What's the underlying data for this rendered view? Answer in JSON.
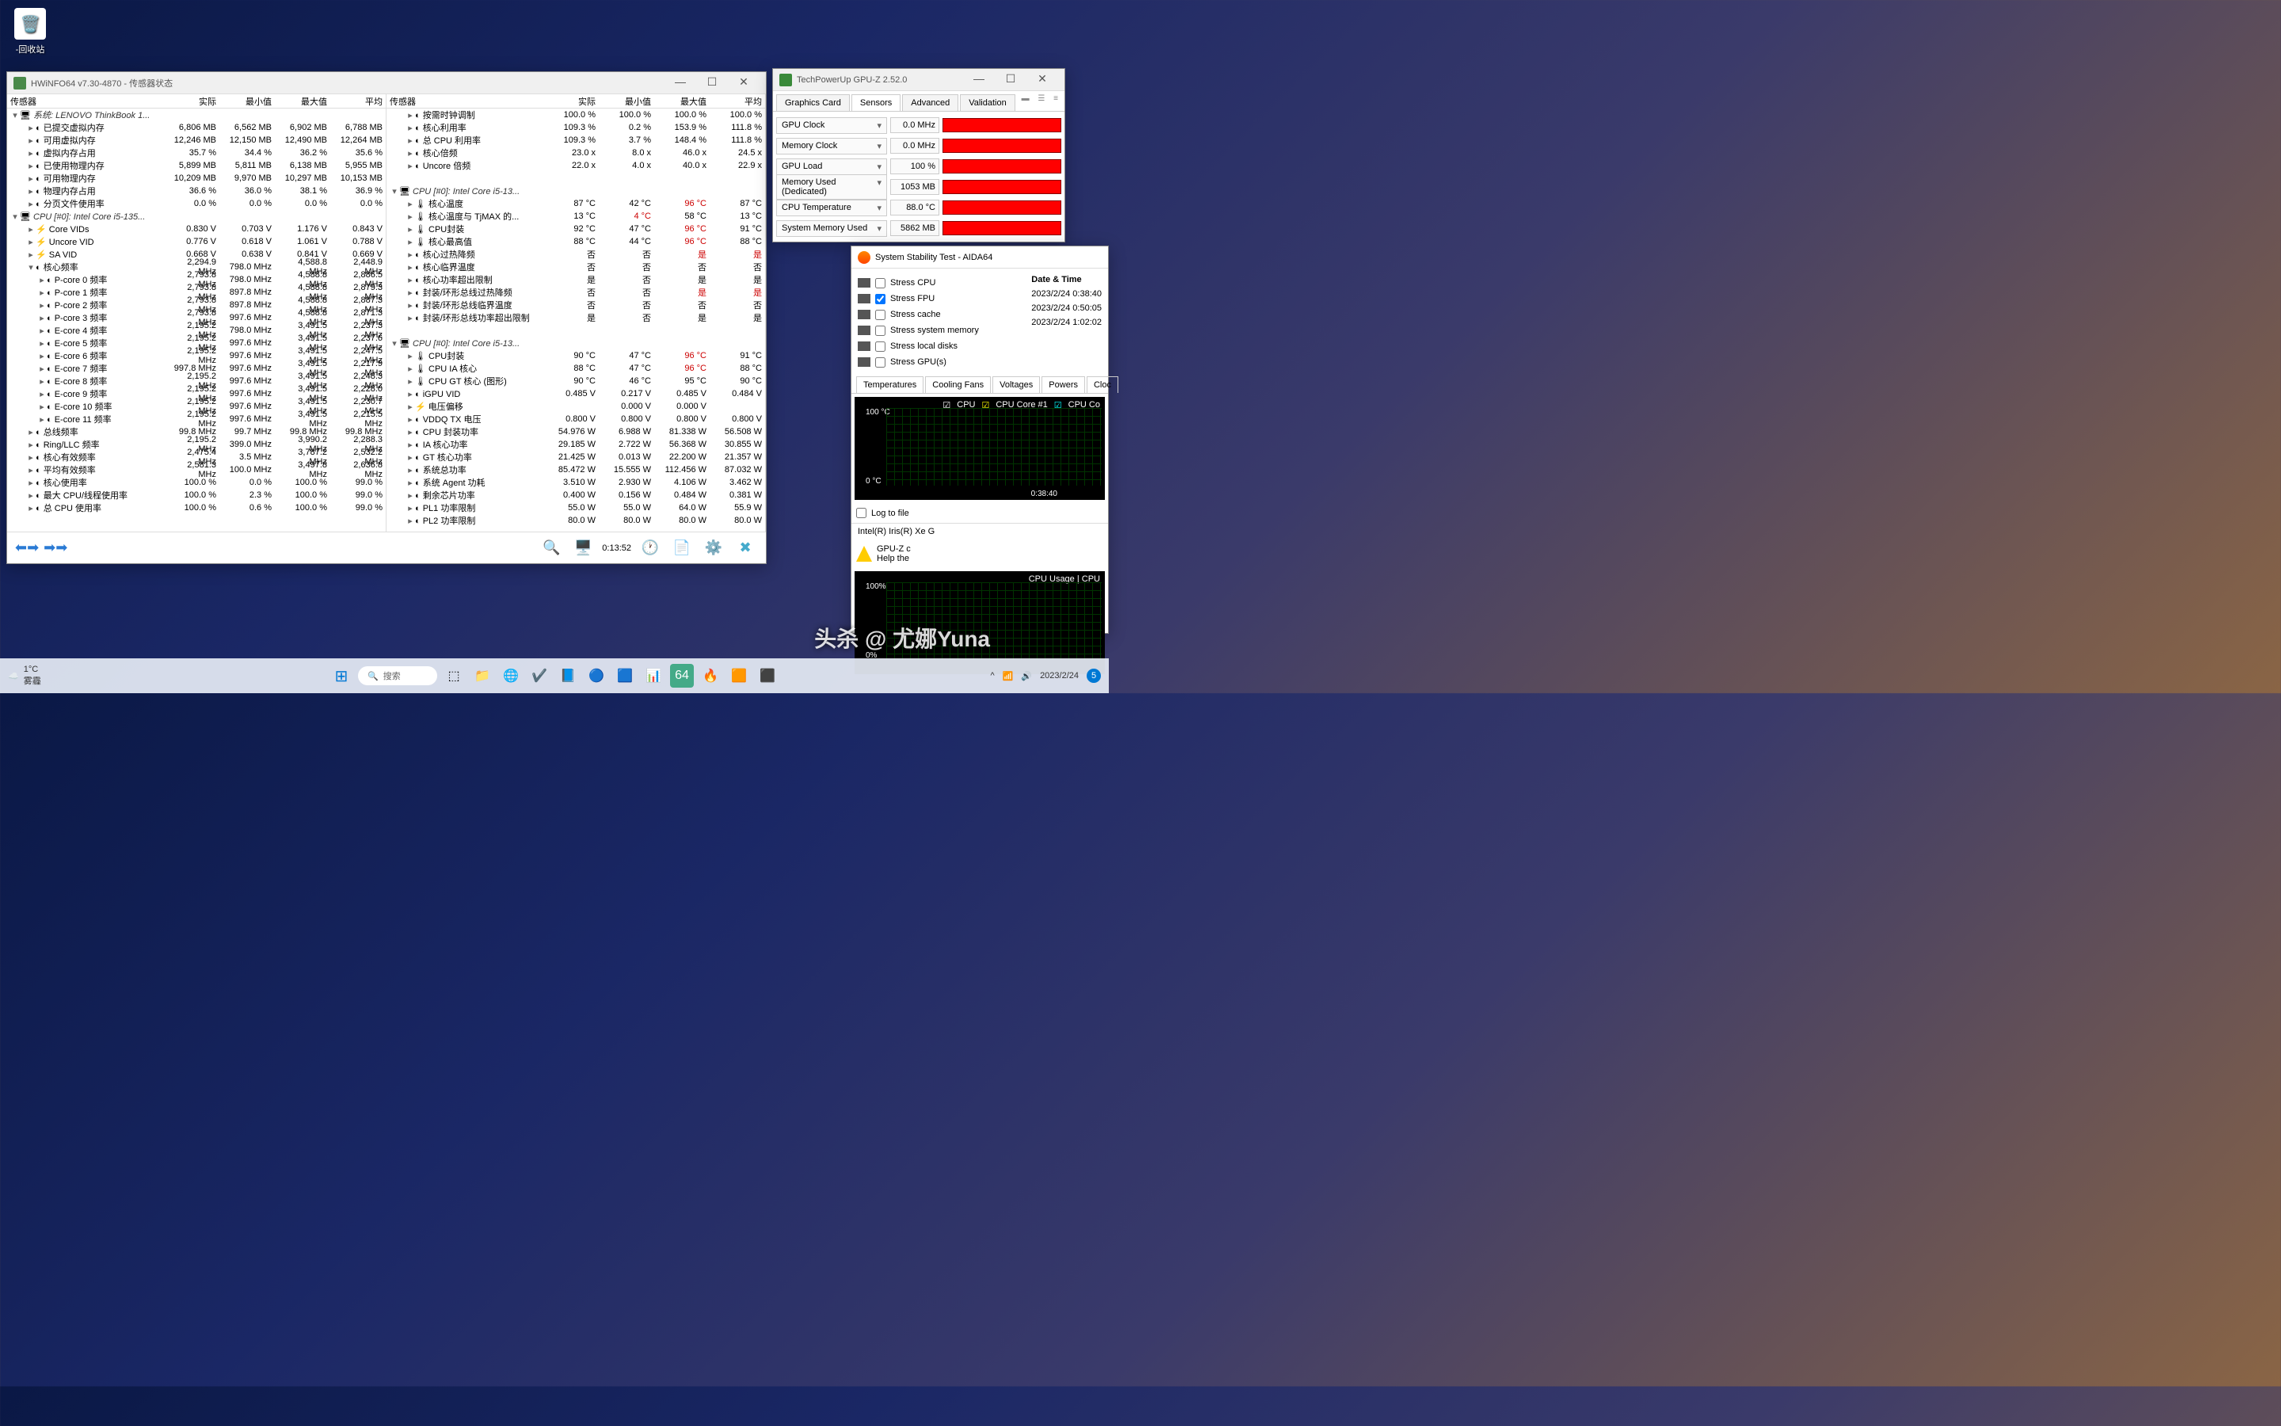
{
  "desktop": {
    "recycle": "-回收站"
  },
  "hwinfo": {
    "title": "HWiNFO64 v7.30-4870 - 传感器状态",
    "hdr": [
      "传感器",
      "实际",
      "最小值",
      "最大值",
      "平均"
    ],
    "left": [
      {
        "t": "grp",
        "n": "系统: LENOVO ThinkBook 1...",
        "i": 0
      },
      {
        "n": "已提交虚拟内存",
        "v": [
          "6,806 MB",
          "6,562 MB",
          "6,902 MB",
          "6,788 MB"
        ],
        "i": 1
      },
      {
        "n": "可用虚拟内存",
        "v": [
          "12,246 MB",
          "12,150 MB",
          "12,490 MB",
          "12,264 MB"
        ],
        "i": 1
      },
      {
        "n": "虚拟内存占用",
        "v": [
          "35.7 %",
          "34.4 %",
          "36.2 %",
          "35.6 %"
        ],
        "i": 1
      },
      {
        "n": "已使用物理内存",
        "v": [
          "5,899 MB",
          "5,811 MB",
          "6,138 MB",
          "5,955 MB"
        ],
        "i": 1
      },
      {
        "n": "可用物理内存",
        "v": [
          "10,209 MB",
          "9,970 MB",
          "10,297 MB",
          "10,153 MB"
        ],
        "i": 1
      },
      {
        "n": "物理内存占用",
        "v": [
          "36.6 %",
          "36.0 %",
          "38.1 %",
          "36.9 %"
        ],
        "i": 1
      },
      {
        "n": "分页文件使用率",
        "v": [
          "0.0 %",
          "0.0 %",
          "0.0 %",
          "0.0 %"
        ],
        "i": 1
      },
      {
        "t": "grp",
        "n": "CPU [#0]: Intel Core i5-135...",
        "i": 0
      },
      {
        "n": "Core VIDs",
        "v": [
          "0.830 V",
          "0.703 V",
          "1.176 V",
          "0.843 V"
        ],
        "i": 1,
        "ic": "⚡"
      },
      {
        "n": "Uncore VID",
        "v": [
          "0.776 V",
          "0.618 V",
          "1.061 V",
          "0.788 V"
        ],
        "i": 1,
        "ic": "⚡"
      },
      {
        "n": "SA VID",
        "v": [
          "0.668 V",
          "0.638 V",
          "0.841 V",
          "0.669 V"
        ],
        "i": 1,
        "ic": "⚡"
      },
      {
        "n": "核心频率",
        "v": [
          "2,294.9 MHz",
          "798.0 MHz",
          "4,588.8 MHz",
          "2,448.9 MHz"
        ],
        "i": 1,
        "exp": "v"
      },
      {
        "n": "P-core 0 频率",
        "v": [
          "2,793.8 MHz",
          "798.0 MHz",
          "4,588.8 MHz",
          "2,886.5 MHz"
        ],
        "i": 2
      },
      {
        "n": "P-core 1 频率",
        "v": [
          "2,793.8 MHz",
          "897.8 MHz",
          "4,588.8 MHz",
          "2,879.3 MHz"
        ],
        "i": 2
      },
      {
        "n": "P-core 2 频率",
        "v": [
          "2,793.8 MHz",
          "897.8 MHz",
          "4,588.8 MHz",
          "2,887.3 MHz"
        ],
        "i": 2
      },
      {
        "n": "P-core 3 频率",
        "v": [
          "2,793.8 MHz",
          "997.6 MHz",
          "4,588.8 MHz",
          "2,871.3 MHz"
        ],
        "i": 2
      },
      {
        "n": "E-core 4 频率",
        "v": [
          "2,195.2 MHz",
          "798.0 MHz",
          "3,491.5 MHz",
          "2,237.3 MHz"
        ],
        "i": 2
      },
      {
        "n": "E-core 5 频率",
        "v": [
          "2,195.2 MHz",
          "997.6 MHz",
          "3,491.5 MHz",
          "2,237.6 MHz"
        ],
        "i": 2
      },
      {
        "n": "E-core 6 频率",
        "v": [
          "2,195.2 MHz",
          "997.6 MHz",
          "3,491.5 MHz",
          "2,247.5 MHz"
        ],
        "i": 2
      },
      {
        "n": "E-core 7 频率",
        "v": [
          "997.8 MHz",
          "997.6 MHz",
          "3,491.5 MHz",
          "2,217.9 MHz"
        ],
        "i": 2
      },
      {
        "n": "E-core 8 频率",
        "v": [
          "2,195.2 MHz",
          "997.6 MHz",
          "3,491.5 MHz",
          "2,248.3 MHz"
        ],
        "i": 2
      },
      {
        "n": "E-core 9 频率",
        "v": [
          "2,195.2 MHz",
          "997.6 MHz",
          "3,491.5 MHz",
          "2,228.0 MHz"
        ],
        "i": 2
      },
      {
        "n": "E-core 10 频率",
        "v": [
          "2,195.2 MHz",
          "997.6 MHz",
          "3,491.5 MHz",
          "2,230.7 MHz"
        ],
        "i": 2
      },
      {
        "n": "E-core 11 频率",
        "v": [
          "2,195.2 MHz",
          "997.6 MHz",
          "3,491.5 MHz",
          "2,215.5 MHz"
        ],
        "i": 2
      },
      {
        "n": "总线频率",
        "v": [
          "99.8 MHz",
          "99.7 MHz",
          "99.8 MHz",
          "99.8 MHz"
        ],
        "i": 1
      },
      {
        "n": "Ring/LLC 频率",
        "v": [
          "2,195.2 MHz",
          "399.0 MHz",
          "3,990.2 MHz",
          "2,288.3 MHz"
        ],
        "i": 1
      },
      {
        "n": "核心有效频率",
        "v": [
          "2,475.4 MHz",
          "3.5 MHz",
          "3,787.2 MHz",
          "2,532.2 MHz"
        ],
        "i": 1
      },
      {
        "n": "平均有效频率",
        "v": [
          "2,581.3 MHz",
          "100.0 MHz",
          "3,497.8 MHz",
          "2,636.8 MHz"
        ],
        "i": 1
      },
      {
        "n": "核心使用率",
        "v": [
          "100.0 %",
          "0.0 %",
          "100.0 %",
          "99.0 %"
        ],
        "i": 1
      },
      {
        "n": "最大 CPU/线程使用率",
        "v": [
          "100.0 %",
          "2.3 %",
          "100.0 %",
          "99.0 %"
        ],
        "i": 1
      },
      {
        "n": "总 CPU 使用率",
        "v": [
          "100.0 %",
          "0.6 %",
          "100.0 %",
          "99.0 %"
        ],
        "i": 1
      }
    ],
    "right": [
      {
        "n": "按需时钟调制",
        "v": [
          "100.0 %",
          "100.0 %",
          "100.0 %",
          "100.0 %"
        ],
        "i": 1
      },
      {
        "n": "核心利用率",
        "v": [
          "109.3 %",
          "0.2 %",
          "153.9 %",
          "111.8 %"
        ],
        "i": 1
      },
      {
        "n": "总 CPU 利用率",
        "v": [
          "109.3 %",
          "3.7 %",
          "148.4 %",
          "111.8 %"
        ],
        "i": 1
      },
      {
        "n": "核心倍频",
        "v": [
          "23.0 x",
          "8.0 x",
          "46.0 x",
          "24.5 x"
        ],
        "i": 1
      },
      {
        "n": "Uncore 倍频",
        "v": [
          "22.0 x",
          "4.0 x",
          "40.0 x",
          "22.9 x"
        ],
        "i": 1
      },
      {
        "t": "sp"
      },
      {
        "t": "grp",
        "n": "CPU [#0]: Intel Core i5-13...",
        "i": 0
      },
      {
        "n": "核心温度",
        "v": [
          "87 °C",
          "42 °C",
          "96 °C",
          "87 °C"
        ],
        "i": 1,
        "ic": "🌡",
        "hot": 2
      },
      {
        "n": "核心温度与 TjMAX 的...",
        "v": [
          "13 °C",
          "4 °C",
          "58 °C",
          "13 °C"
        ],
        "i": 1,
        "ic": "🌡",
        "hot": 1
      },
      {
        "n": "CPU封装",
        "v": [
          "92 °C",
          "47 °C",
          "96 °C",
          "91 °C"
        ],
        "i": 1,
        "ic": "🌡",
        "hot": 2
      },
      {
        "n": "核心最高值",
        "v": [
          "88 °C",
          "44 °C",
          "96 °C",
          "88 °C"
        ],
        "i": 1,
        "ic": "🌡",
        "hot": 2
      },
      {
        "n": "核心过热降频",
        "v": [
          "否",
          "否",
          "是",
          "是"
        ],
        "i": 1,
        "hot": 3
      },
      {
        "n": "核心临界温度",
        "v": [
          "否",
          "否",
          "否",
          "否"
        ],
        "i": 1
      },
      {
        "n": "核心功率超出限制",
        "v": [
          "是",
          "否",
          "是",
          "是"
        ],
        "i": 1
      },
      {
        "n": "封装/环形总线过热降频",
        "v": [
          "否",
          "否",
          "是",
          "是"
        ],
        "i": 1,
        "hot": 3
      },
      {
        "n": "封装/环形总线临界温度",
        "v": [
          "否",
          "否",
          "否",
          "否"
        ],
        "i": 1
      },
      {
        "n": "封装/环形总线功率超出限制",
        "v": [
          "是",
          "否",
          "是",
          "是"
        ],
        "i": 1
      },
      {
        "t": "sp"
      },
      {
        "t": "grp",
        "n": "CPU [#0]: Intel Core i5-13...",
        "i": 0
      },
      {
        "n": "CPU封装",
        "v": [
          "90 °C",
          "47 °C",
          "96 °C",
          "91 °C"
        ],
        "i": 1,
        "ic": "🌡",
        "hot": 2
      },
      {
        "n": "CPU IA 核心",
        "v": [
          "88 °C",
          "47 °C",
          "96 °C",
          "88 °C"
        ],
        "i": 1,
        "ic": "🌡",
        "hot": 2
      },
      {
        "n": "CPU GT 核心 (图形)",
        "v": [
          "90 °C",
          "46 °C",
          "95 °C",
          "90 °C"
        ],
        "i": 1,
        "ic": "🌡"
      },
      {
        "n": "iGPU VID",
        "v": [
          "0.485 V",
          "0.217 V",
          "0.485 V",
          "0.484 V"
        ],
        "i": 1
      },
      {
        "n": "电压偏移",
        "v": [
          "",
          "0.000 V",
          "0.000 V",
          ""
        ],
        "i": 1,
        "ic": "⚡"
      },
      {
        "n": "VDDQ TX 电压",
        "v": [
          "0.800 V",
          "0.800 V",
          "0.800 V",
          "0.800 V"
        ],
        "i": 1
      },
      {
        "n": "CPU 封装功率",
        "v": [
          "54.976 W",
          "6.988 W",
          "81.338 W",
          "56.508 W"
        ],
        "i": 1
      },
      {
        "n": "IA 核心功率",
        "v": [
          "29.185 W",
          "2.722 W",
          "56.368 W",
          "30.855 W"
        ],
        "i": 1
      },
      {
        "n": "GT 核心功率",
        "v": [
          "21.425 W",
          "0.013 W",
          "22.200 W",
          "21.357 W"
        ],
        "i": 1
      },
      {
        "n": "系统总功率",
        "v": [
          "85.472 W",
          "15.555 W",
          "112.456 W",
          "87.032 W"
        ],
        "i": 1
      },
      {
        "n": "系统 Agent 功耗",
        "v": [
          "3.510 W",
          "2.930 W",
          "4.106 W",
          "3.462 W"
        ],
        "i": 1
      },
      {
        "n": "剩余芯片功率",
        "v": [
          "0.400 W",
          "0.156 W",
          "0.484 W",
          "0.381 W"
        ],
        "i": 1
      },
      {
        "n": "PL1 功率限制",
        "v": [
          "55.0 W",
          "55.0 W",
          "64.0 W",
          "55.9 W"
        ],
        "i": 1
      },
      {
        "n": "PL2 功率限制",
        "v": [
          "80.0 W",
          "80.0 W",
          "80.0 W",
          "80.0 W"
        ],
        "i": 1
      }
    ],
    "elapsed": "0:13:52"
  },
  "gpuz": {
    "title": "TechPowerUp GPU-Z 2.52.0",
    "tabs": [
      "Graphics Card",
      "Sensors",
      "Advanced",
      "Validation"
    ],
    "rows": [
      {
        "l": "GPU Clock",
        "v": "0.0 MHz"
      },
      {
        "l": "Memory Clock",
        "v": "0.0 MHz"
      },
      {
        "l": "GPU Load",
        "v": "100 %"
      },
      {
        "l": "Memory Used (Dedicated)",
        "v": "1053 MB"
      },
      {
        "l": "CPU Temperature",
        "v": "88.0 °C"
      },
      {
        "l": "System Memory Used",
        "v": "5862 MB"
      }
    ],
    "log": "Log to file",
    "gpu": "Intel(R) Iris(R) Xe G",
    "msg1": "GPU-Z c",
    "msg2": "Help the"
  },
  "aida": {
    "title": "System Stability Test - AIDA64",
    "checks": [
      {
        "l": "Stress CPU",
        "c": false
      },
      {
        "l": "Stress FPU",
        "c": true
      },
      {
        "l": "Stress cache",
        "c": false
      },
      {
        "l": "Stress system memory",
        "c": false
      },
      {
        "l": "Stress local disks",
        "c": false
      },
      {
        "l": "Stress GPU(s)",
        "c": false
      }
    ],
    "datehdr": "Date & Time",
    "dates": [
      "2023/2/24 0:38:40",
      "2023/2/24 0:50:05",
      "2023/2/24 1:02:02"
    ],
    "mtabs": [
      "Temperatures",
      "Cooling Fans",
      "Voltages",
      "Powers",
      "Cloc"
    ],
    "graph1": {
      "y1": "100 °C",
      "y2": "0 °C",
      "legend": [
        "CPU",
        "CPU Core #1",
        "CPU Co"
      ],
      "xt": "0:38:40"
    },
    "graph2": {
      "y1": "100%",
      "y2": "0%",
      "legend": "CPU Usage  |  CPU"
    }
  },
  "taskbar": {
    "temp": "1°C",
    "cond": "雾霾",
    "search": "搜索",
    "clock": "2023/2/24",
    "badge": "5"
  },
  "watermark": "头杀 @ 尤娜Yuna"
}
